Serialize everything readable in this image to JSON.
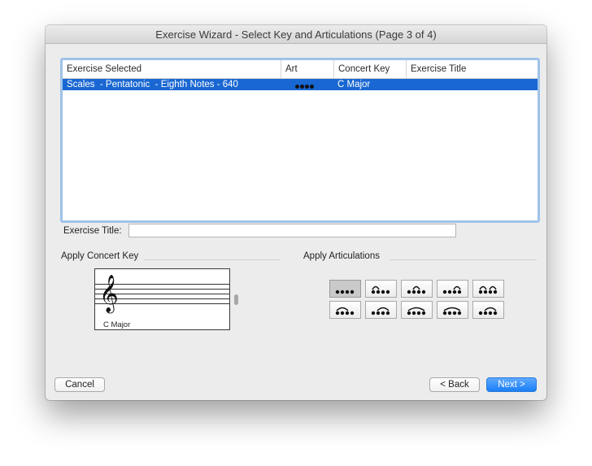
{
  "window": {
    "title": "Exercise Wizard - Select Key and Articulations (Page 3 of 4)"
  },
  "table": {
    "columns": [
      "Exercise Selected",
      "Art",
      "Concert Key",
      "Exercise Title"
    ],
    "rows": [
      {
        "exercise": "Scales  - Pentatonic  - Eighth Notes - 640",
        "art": "four-dots",
        "key": "C Major",
        "title": ""
      }
    ]
  },
  "exercise_title": {
    "label": "Exercise Title:",
    "value": ""
  },
  "concert_key": {
    "group_label": "Apply Concert Key",
    "selected": "C Major",
    "clef": "treble-clef"
  },
  "articulations": {
    "group_label": "Apply Articulations",
    "patterns": [
      {
        "name": "no-slur",
        "slur": []
      },
      {
        "name": "slur-1-2",
        "slur": [
          [
            0,
            1
          ]
        ]
      },
      {
        "name": "slur-2-3",
        "slur": [
          [
            1,
            2
          ]
        ]
      },
      {
        "name": "slur-3-4",
        "slur": [
          [
            2,
            3
          ]
        ]
      },
      {
        "name": "slur-1-2-3-4",
        "slur": [
          [
            0,
            1
          ],
          [
            2,
            3
          ]
        ]
      },
      {
        "name": "slur-1-3",
        "slur": [
          [
            0,
            2
          ]
        ]
      },
      {
        "name": "slur-2-4",
        "slur": [
          [
            1,
            3
          ]
        ]
      },
      {
        "name": "slur-1-4",
        "slur": [
          [
            0,
            3
          ]
        ]
      },
      {
        "name": "slur-1-4-tie",
        "slur": [
          [
            0,
            3
          ]
        ]
      },
      {
        "name": "slur-2-4-accent",
        "slur": [
          [
            1,
            3
          ]
        ]
      }
    ],
    "selected": 0
  },
  "buttons": {
    "cancel": "Cancel",
    "back": "< Back",
    "next": "Next >"
  }
}
